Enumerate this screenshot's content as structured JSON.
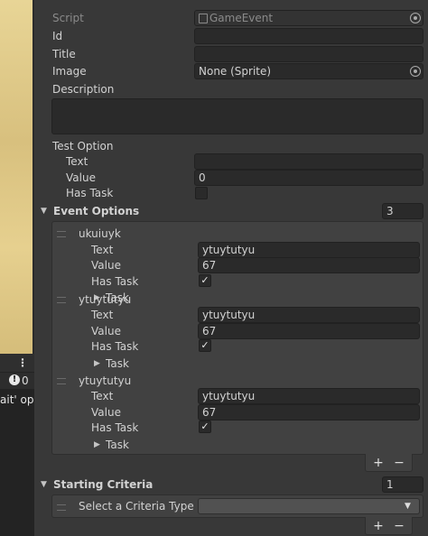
{
  "left_panel": {
    "badge_count": "0",
    "menu_glyph": "⋮",
    "snippet": "ait' op"
  },
  "inspector": {
    "script": {
      "label": "Script",
      "value": "GameEvent"
    },
    "id": {
      "label": "Id",
      "value": ""
    },
    "title": {
      "label": "Title",
      "value": ""
    },
    "image": {
      "label": "Image",
      "value": "None (Sprite)"
    },
    "description": {
      "label": "Description",
      "value": ""
    },
    "test_option": {
      "label": "Test Option",
      "text_label": "Text",
      "text_value": "",
      "value_label": "Value",
      "value_value": "0",
      "has_task_label": "Has Task",
      "has_task_checked": false
    },
    "event_options": {
      "label": "Event Options",
      "count": "3",
      "items": [
        {
          "name": "ukuiuyk",
          "text_label": "Text",
          "text_value": "ytuytutyu",
          "value_label": "Value",
          "value_value": "67",
          "has_task_label": "Has Task",
          "has_task_checked": true,
          "task_label": "Task"
        },
        {
          "name": "ytuytutyu",
          "text_label": "Text",
          "text_value": "ytuytutyu",
          "value_label": "Value",
          "value_value": "67",
          "has_task_label": "Has Task",
          "has_task_checked": true,
          "task_label": "Task"
        },
        {
          "name": "ytuytutyu",
          "text_label": "Text",
          "text_value": "ytuytutyu",
          "value_label": "Value",
          "value_value": "67",
          "has_task_label": "Has Task",
          "has_task_checked": true,
          "task_label": "Task"
        }
      ],
      "add_label": "+",
      "remove_label": "−"
    },
    "starting_criteria": {
      "label": "Starting Criteria",
      "count": "1",
      "item_label": "Select a Criteria Type",
      "dropdown_value": "",
      "add_label": "+",
      "remove_label": "−"
    }
  },
  "colors": {
    "panel_bg": "#383838",
    "field_bg": "#2a2a2a",
    "list_bg": "#414141",
    "parchment": "#e3cf8f"
  }
}
